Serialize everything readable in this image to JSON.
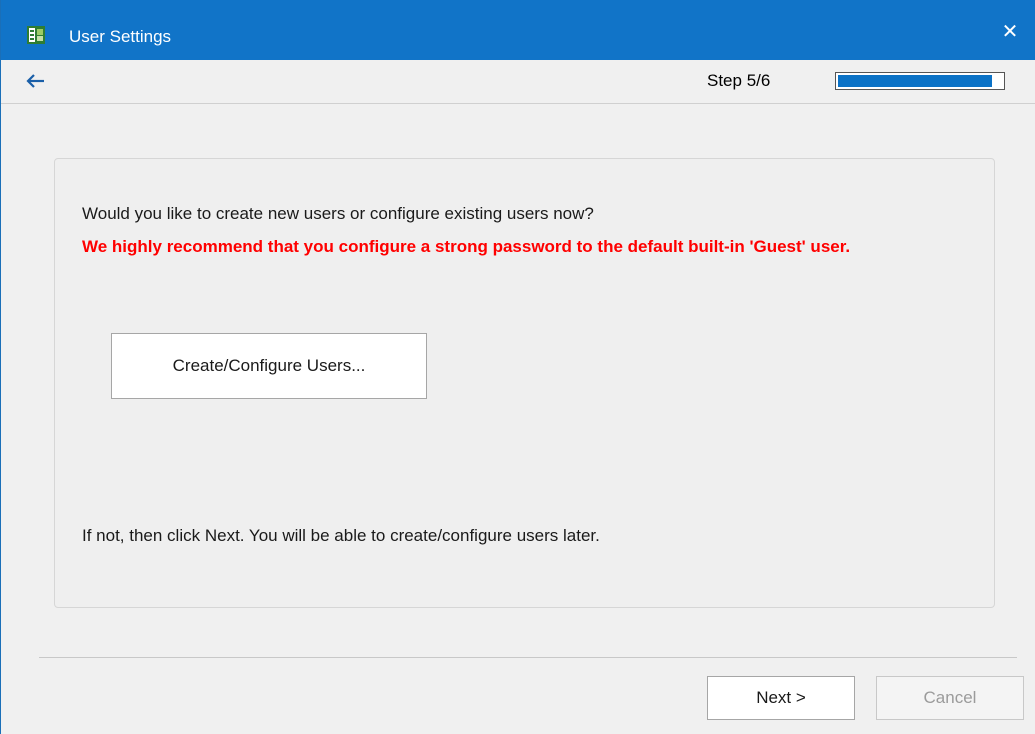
{
  "window": {
    "title": "User Settings",
    "close_glyph": "✕",
    "app_icon": "setup-wizard-icon"
  },
  "nav": {
    "back_icon": "back-arrow-icon",
    "step_label": "Step 5/6",
    "progress_fraction": 0.94
  },
  "content": {
    "question": "Would you like to create new users or configure existing users now?",
    "warning": "We highly recommend that you configure a strong password to the default built-in 'Guest' user.",
    "configure_button_label": "Create/Configure Users...",
    "hint": "If not, then click Next. You will be able to create/configure users later."
  },
  "footer": {
    "next_label": "Next >",
    "cancel_label": "Cancel"
  },
  "colors": {
    "titlebar": "#1174c8",
    "progress": "#0b72c6",
    "warning": "#ff0000"
  }
}
